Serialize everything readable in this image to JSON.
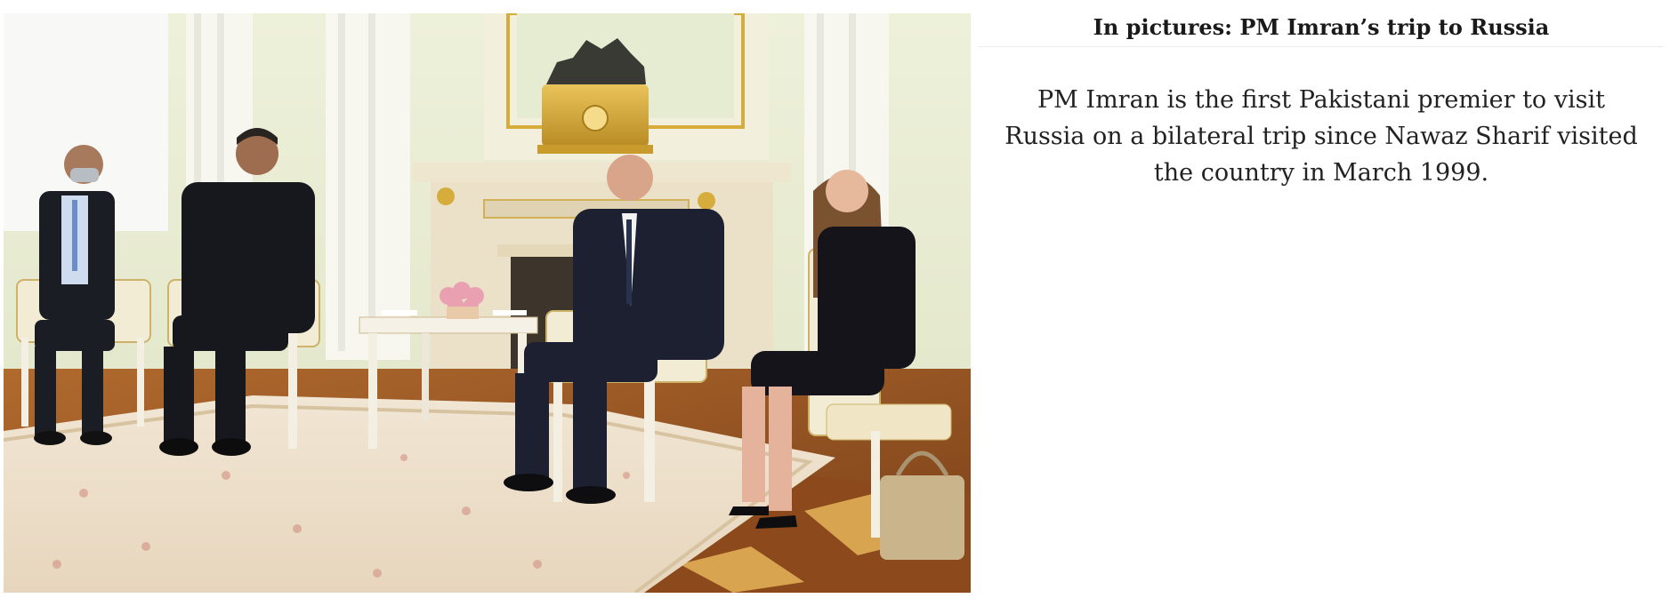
{
  "article": {
    "title": "In pictures: PM Imran’s trip to Russia",
    "caption": "PM Imran is the first Pakistani premier to visit Russia on a bilateral trip since Nawaz Sharif visited the country in March 1999."
  },
  "colors": {
    "background": "#ffffff",
    "title_text": "#1a1a1a",
    "body_text": "#222222",
    "divider": "#ececec"
  }
}
